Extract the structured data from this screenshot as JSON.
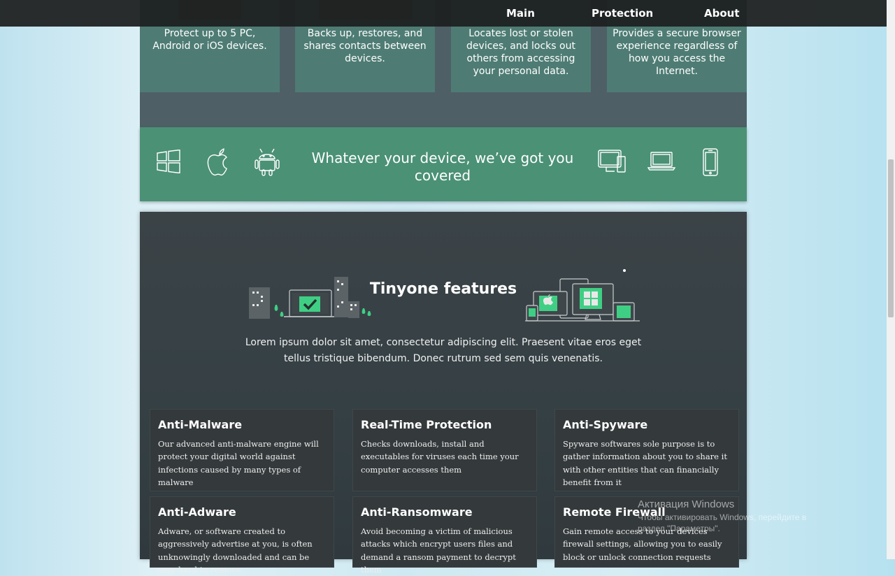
{
  "nav": {
    "links": [
      {
        "label": "Main"
      },
      {
        "label": "Protection"
      },
      {
        "label": "About"
      }
    ]
  },
  "top_cards": [
    {
      "text": "Protect up to 5 PC, Android or iOS devices."
    },
    {
      "text": "Backs up, restores, and shares contacts between devices."
    },
    {
      "text": "Locates lost or stolen devices, and locks out others from accessing your personal data."
    },
    {
      "text": "Provides a secure browser experience regardless of how you access the Internet."
    }
  ],
  "device_band": {
    "title": "Whatever your device, we’ve got you covered",
    "icons_left": [
      "windows-icon",
      "apple-icon",
      "android-icon"
    ],
    "icons_right": [
      "desktop-icon",
      "laptop-icon",
      "phone-icon"
    ]
  },
  "features": {
    "heading": "Tinyone features",
    "lead": "Lorem ipsum dolor sit amet, consectetur adipiscing elit. Praesent vitae eros eget tellus tristique bibendum. Donec rutrum sed sem quis venenatis.",
    "items": [
      {
        "title": "Anti-Malware",
        "desc": "Our advanced anti-malware engine will protect your digital world against infections caused by many types of malware"
      },
      {
        "title": "Real-Time Protection",
        "desc": "Checks downloads, install and executables for viruses each time your computer accesses them"
      },
      {
        "title": "Anti-Spyware",
        "desc": "Spyware softwares sole purpose is to gather information about you to share it with other entities that can financially benefit from it"
      },
      {
        "title": "Anti-Adware",
        "desc": "Adware, or software created to aggressively advertise at you, is often unknowingly downloaded and can be very hard to remove"
      },
      {
        "title": "Anti-Ransomware",
        "desc": "Avoid becoming a victim of malicious attacks which encrypt users files and demand a ransom payment to decrypt them"
      },
      {
        "title": "Remote Firewall",
        "desc": "Gain remote access to your devices firewall settings, allowing you to easily block or unlock connection requests"
      }
    ]
  },
  "os_watermark": {
    "line1": "Активация Windows",
    "line2": "Чтобы активировать Windows, перейдите в раздел \"Параметры\"."
  },
  "colors": {
    "nav_bg": "#1e2020",
    "card_green": "#4e7c74",
    "band_green": "#4b9176",
    "features_bg": "#354045",
    "box_bg": "#34393b",
    "accent_green": "#3fcf84"
  }
}
